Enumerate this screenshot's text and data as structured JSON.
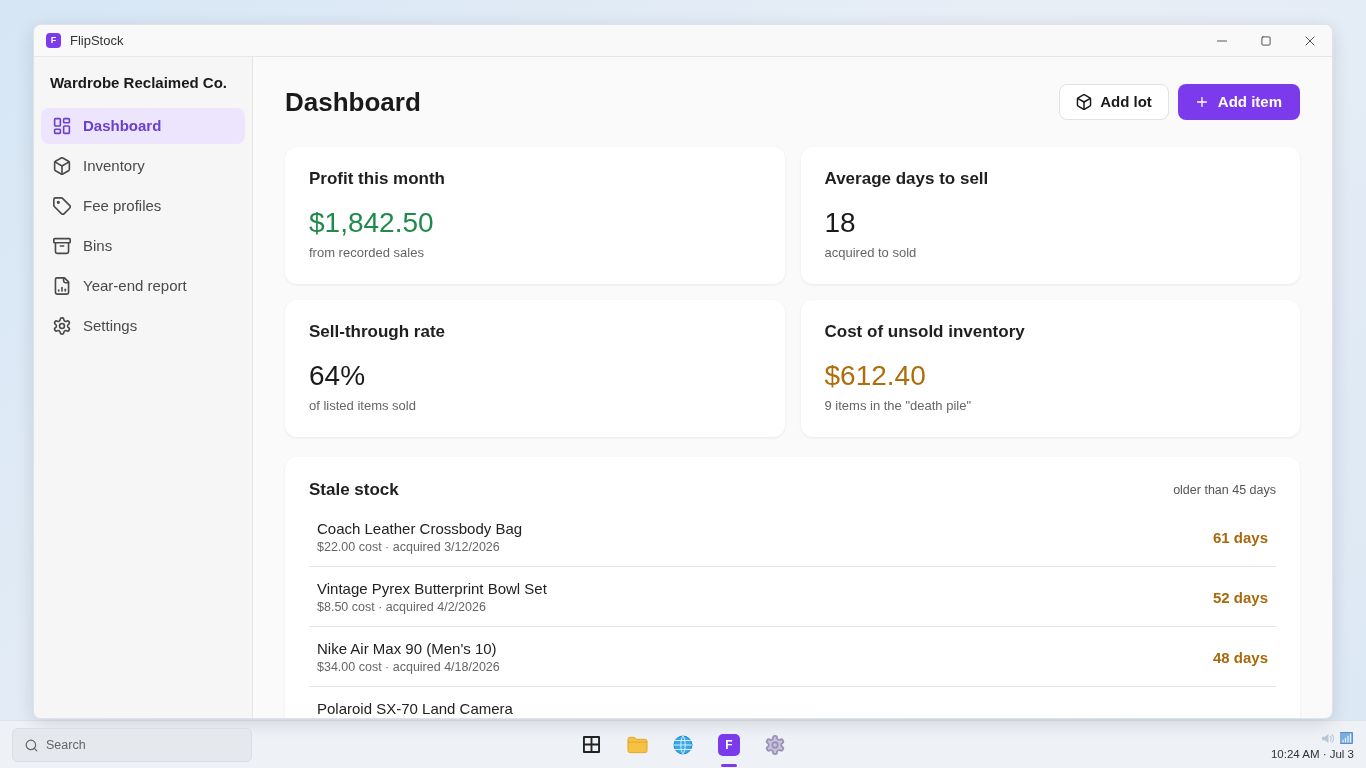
{
  "window": {
    "logo_letter": "F",
    "title": "FlipStock"
  },
  "sidebar": {
    "brand": "Wardrobe Reclaimed Co.",
    "items": [
      {
        "label": "Dashboard",
        "selected": true
      },
      {
        "label": "Inventory",
        "selected": false
      },
      {
        "label": "Fee profiles",
        "selected": false
      },
      {
        "label": "Bins",
        "selected": false
      },
      {
        "label": "Year-end report",
        "selected": false
      },
      {
        "label": "Settings",
        "selected": false
      }
    ]
  },
  "header": {
    "title": "Dashboard",
    "buttons": [
      {
        "label": "Add lot",
        "kind": "secondary"
      },
      {
        "label": "Add item",
        "kind": "primary"
      }
    ]
  },
  "stats": [
    {
      "title": "Profit this month",
      "value": "$1,842.50",
      "caption": "from recorded sales",
      "color": "#1f8a4c"
    },
    {
      "title": "Average days to sell",
      "value": "18",
      "caption": "acquired to sold",
      "color": "#1a1a1a"
    },
    {
      "title": "Sell-through rate",
      "value": "64%",
      "caption": "of listed items sold",
      "color": "#1a1a1a"
    },
    {
      "title": "Cost of unsold inventory",
      "value": "$612.40",
      "caption": "9 items in the \"death pile\"",
      "color": "#b06d0c"
    }
  ],
  "stale_stock": {
    "title": "Stale stock",
    "note": "older than 45 days",
    "rows": [
      {
        "name": "Coach Leather Crossbody Bag",
        "details": "$22.00 cost · acquired 3/12/2026",
        "age": "61 days"
      },
      {
        "name": "Vintage Pyrex Butterprint Bowl Set",
        "details": "$8.50 cost · acquired 4/2/2026",
        "age": "52 days"
      },
      {
        "name": "Nike Air Max 90 (Men's 10)",
        "details": "$34.00 cost · acquired 4/18/2026",
        "age": "48 days"
      },
      {
        "name": "Polaroid SX-70 Land Camera"
      }
    ]
  },
  "taskbar": {
    "search": {
      "placeholder": "Search"
    },
    "apps": [
      {
        "kind": "start",
        "active": false
      },
      {
        "kind": "files",
        "active": false
      },
      {
        "kind": "browser",
        "active": false
      },
      {
        "kind": "flipstock",
        "label": "F",
        "active": true
      },
      {
        "kind": "settings",
        "active": false
      }
    ],
    "clock": "10:24 AM · Jul 3"
  }
}
